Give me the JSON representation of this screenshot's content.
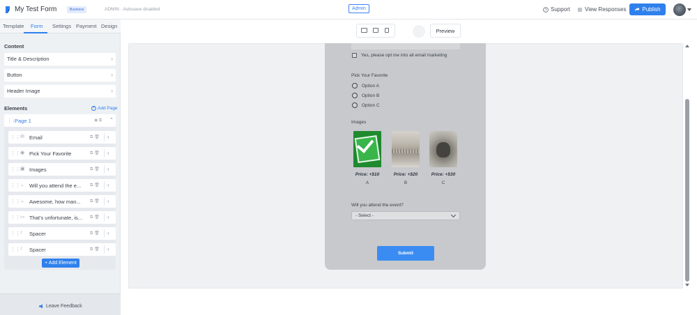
{
  "header": {
    "title": "My Test Form",
    "plan_badge": "Business",
    "admin_note": "ADMIN · Autosave disabled",
    "admin_label": "Admin",
    "support_label": "Support",
    "view_responses_label": "View Responses",
    "publish_label": "Publish"
  },
  "sidebar": {
    "tabs": [
      {
        "label": "Template"
      },
      {
        "label": "Form"
      },
      {
        "label": "Settings"
      },
      {
        "label": "Payment"
      },
      {
        "label": "Design"
      }
    ],
    "active_tab": "Form",
    "content_heading": "Content",
    "content_items": [
      {
        "label": "Title & Description"
      },
      {
        "label": "Button"
      },
      {
        "label": "Header Image"
      }
    ],
    "elements_heading": "Elements",
    "add_page_label": "Add Page",
    "page_label": "Page 1",
    "elements": [
      {
        "label": "Email",
        "icon": "email-icon"
      },
      {
        "label": "Pick Your Favorite",
        "icon": "radio-icon"
      },
      {
        "label": "Images",
        "icon": "image-icon"
      },
      {
        "label": "Will you attend the e...",
        "icon": "dropdown-icon"
      },
      {
        "label": "Awesome, how man...",
        "icon": "dropdown-icon"
      },
      {
        "label": "That's unfortunate, is...",
        "icon": "text-field-icon"
      },
      {
        "label": "Spacer",
        "icon": "spacer-icon"
      },
      {
        "label": "Spacer",
        "icon": "spacer-icon"
      }
    ],
    "add_element_label": "+ Add Element",
    "feedback_label": "Leave Feedback"
  },
  "toolbar": {
    "preview_label": "Preview"
  },
  "form": {
    "marketing_opt_in": "Yes, please opt me into all email marketing",
    "favorite_question": "Pick Your Favorite",
    "favorite_options": [
      "Option A",
      "Option B",
      "Option C"
    ],
    "images_question": "Images",
    "image_options": [
      {
        "price": "Price: +$10",
        "letter": "A"
      },
      {
        "price": "Price: +$20",
        "letter": "B"
      },
      {
        "price": "Price: +$30",
        "letter": "C"
      }
    ],
    "attend_question": "Will you attend the event?",
    "attend_select_value": "- Select -",
    "submit_label": "Submit"
  },
  "colors": {
    "accent": "#2f80ed",
    "form_overlay": "#c7c9cc",
    "submit": "#3b8cf2"
  }
}
